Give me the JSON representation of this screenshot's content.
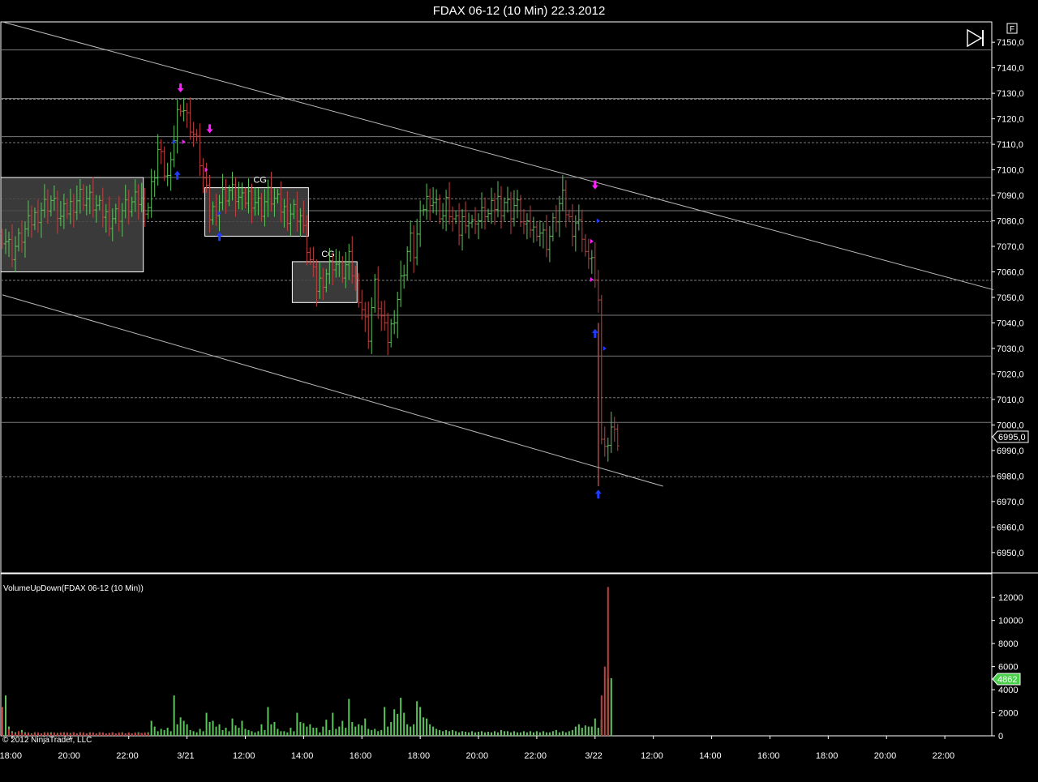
{
  "title": "FDAX 06-12 (10 Min)  22.3.2012",
  "copyright": "© 2012 NinjaTrader, LLC",
  "f_button": "F",
  "indicator_label": "VolumeUpDown(FDAX 06-12 (10 Min))",
  "box_labels": [
    "CG",
    "CG"
  ],
  "colors": {
    "up": "#5ec45e",
    "down": "#c04040",
    "grid": "#7a7a7a",
    "frame": "#ffffff",
    "box": "#444444",
    "buy": "#1e3cff",
    "sell": "#ff20ff"
  },
  "chart_data": [
    {
      "type": "candlestick",
      "title": "FDAX 06-12 (10 Min)  22.3.2012",
      "ylim": [
        6942,
        7158
      ],
      "yticks": [
        "7150,0",
        "7140,0",
        "7130,0",
        "7120,0",
        "7110,0",
        "7100,0",
        "7090,0",
        "7080,0",
        "7070,0",
        "7060,0",
        "7050,0",
        "7040,0",
        "7030,0",
        "7020,0",
        "7010,0",
        "7000,0",
        "6990,0",
        "6980,0",
        "6970,0",
        "6960,0",
        "6950,0"
      ],
      "last_price": "6995,0",
      "xticks": [
        "18:00",
        "20:00",
        "22:00",
        "3/21",
        "12:00",
        "14:00",
        "16:00",
        "18:00",
        "20:00",
        "22:00",
        "3/22",
        "12:00",
        "14:00",
        "16:00",
        "18:00",
        "20:00",
        "22:00"
      ],
      "price_path": [
        [
          0,
          7075
        ],
        [
          3,
          7068
        ],
        [
          6,
          7074
        ],
        [
          9,
          7080
        ],
        [
          12,
          7085
        ],
        [
          15,
          7088
        ],
        [
          18,
          7081
        ],
        [
          21,
          7086
        ],
        [
          24,
          7090
        ],
        [
          27,
          7088
        ],
        [
          30,
          7084
        ],
        [
          33,
          7081
        ],
        [
          36,
          7083
        ],
        [
          39,
          7086
        ],
        [
          42,
          7088
        ],
        [
          45,
          7086
        ],
        [
          47,
          7100
        ],
        [
          48,
          7108
        ],
        [
          49,
          7104
        ],
        [
          50,
          7100
        ],
        [
          51,
          7097
        ],
        [
          52,
          7100
        ],
        [
          53,
          7113
        ],
        [
          54,
          7122
        ],
        [
          55,
          7127
        ],
        [
          56,
          7124
        ],
        [
          57,
          7120
        ],
        [
          58,
          7118
        ],
        [
          59,
          7114
        ],
        [
          60,
          7110
        ],
        [
          61,
          7104
        ],
        [
          62,
          7096
        ],
        [
          63,
          7090
        ],
        [
          64,
          7082
        ],
        [
          66,
          7086
        ],
        [
          68,
          7090
        ],
        [
          70,
          7092
        ],
        [
          72,
          7090
        ],
        [
          74,
          7087
        ],
        [
          76,
          7090
        ],
        [
          78,
          7088
        ],
        [
          80,
          7085
        ],
        [
          82,
          7090
        ],
        [
          84,
          7088
        ],
        [
          86,
          7085
        ],
        [
          88,
          7083
        ],
        [
          90,
          7084
        ],
        [
          92,
          7082
        ],
        [
          93,
          7075
        ],
        [
          94,
          7070
        ],
        [
          95,
          7064
        ],
        [
          96,
          7058
        ],
        [
          97,
          7054
        ],
        [
          98,
          7056
        ],
        [
          99,
          7058
        ],
        [
          100,
          7060
        ],
        [
          101,
          7062
        ],
        [
          102,
          7064
        ],
        [
          103,
          7063
        ],
        [
          104,
          7061
        ],
        [
          105,
          7060
        ],
        [
          106,
          7062
        ],
        [
          107,
          7064
        ],
        [
          108,
          7060
        ],
        [
          109,
          7056
        ],
        [
          110,
          7052
        ],
        [
          111,
          7046
        ],
        [
          112,
          7040
        ],
        [
          113,
          7036
        ],
        [
          114,
          7046
        ],
        [
          115,
          7054
        ],
        [
          116,
          7048
        ],
        [
          117,
          7042
        ],
        [
          118,
          7036
        ],
        [
          119,
          7034
        ],
        [
          120,
          7038
        ],
        [
          121,
          7044
        ],
        [
          122,
          7050
        ],
        [
          123,
          7056
        ],
        [
          124,
          7062
        ],
        [
          125,
          7068
        ],
        [
          126,
          7072
        ],
        [
          127,
          7068
        ],
        [
          128,
          7074
        ],
        [
          129,
          7080
        ],
        [
          130,
          7086
        ],
        [
          131,
          7088
        ],
        [
          132,
          7090
        ],
        [
          133,
          7088
        ],
        [
          134,
          7086
        ],
        [
          135,
          7084
        ],
        [
          136,
          7082
        ],
        [
          137,
          7086
        ],
        [
          138,
          7084
        ],
        [
          139,
          7080
        ],
        [
          140,
          7078
        ],
        [
          141,
          7076
        ],
        [
          142,
          7080
        ],
        [
          143,
          7082
        ],
        [
          144,
          7080
        ],
        [
          145,
          7078
        ],
        [
          146,
          7082
        ],
        [
          147,
          7080
        ],
        [
          148,
          7082
        ],
        [
          149,
          7084
        ],
        [
          150,
          7082
        ],
        [
          151,
          7084
        ],
        [
          152,
          7086
        ],
        [
          153,
          7088
        ],
        [
          154,
          7086
        ],
        [
          155,
          7088
        ],
        [
          156,
          7086
        ],
        [
          157,
          7084
        ],
        [
          158,
          7086
        ],
        [
          159,
          7085
        ],
        [
          160,
          7082
        ],
        [
          161,
          7078
        ],
        [
          162,
          7076
        ],
        [
          163,
          7078
        ],
        [
          164,
          7076
        ],
        [
          165,
          7078
        ],
        [
          166,
          7076
        ],
        [
          167,
          7074
        ],
        [
          168,
          7072
        ],
        [
          169,
          7074
        ],
        [
          170,
          7078
        ],
        [
          171,
          7082
        ],
        [
          172,
          7086
        ],
        [
          173,
          7088
        ],
        [
          174,
          7084
        ],
        [
          175,
          7080
        ],
        [
          176,
          7078
        ],
        [
          177,
          7080
        ],
        [
          178,
          7078
        ],
        [
          179,
          7076
        ],
        [
          180,
          7068
        ],
        [
          181,
          7062
        ],
        [
          182,
          7068
        ],
        [
          183,
          7056
        ],
        [
          184,
          7045
        ],
        [
          185,
          6996
        ],
        [
          186,
          6990
        ],
        [
          187,
          6996
        ],
        [
          188,
          7000
        ],
        [
          189,
          6996
        ],
        [
          190,
          6995
        ]
      ],
      "trendlines": [
        {
          "from": [
            0,
            7158
          ],
          "to": [
            306,
            7053
          ]
        },
        {
          "from": [
            0,
            7051
          ],
          "to": [
            204,
            6976
          ]
        }
      ],
      "horizontal_lines_solid": [
        7147,
        7128,
        7113,
        7097,
        7084,
        7043,
        7027,
        7001
      ],
      "horizontal_lines_dashed": [
        7128,
        7111,
        7089,
        7080,
        7057,
        7011,
        6980
      ],
      "boxes": [
        {
          "from": 0,
          "to": 44,
          "high": 7097,
          "low": 7060,
          "label": ""
        },
        {
          "from": 63,
          "to": 95,
          "high": 7093,
          "low": 7074,
          "label": "CG"
        },
        {
          "from": 90,
          "to": 110,
          "high": 7064,
          "low": 7048,
          "label": "CG"
        }
      ],
      "markers": [
        {
          "x": 55,
          "price": 7131,
          "kind": "sell"
        },
        {
          "x": 64,
          "price": 7115,
          "kind": "sell"
        },
        {
          "x": 183,
          "price": 7093,
          "kind": "sell"
        },
        {
          "x": 54,
          "price": 7099,
          "kind": "buy"
        },
        {
          "x": 67,
          "price": 7075,
          "kind": "buy"
        },
        {
          "x": 183,
          "price": 7037,
          "kind": "buy"
        },
        {
          "x": 184,
          "price": 6974,
          "kind": "buy"
        }
      ]
    },
    {
      "type": "bar",
      "title": "VolumeUpDown(FDAX 06-12 (10 Min))",
      "ylim": [
        0,
        13000
      ],
      "yticks": [
        "12000",
        "10000",
        "8000",
        "6000",
        "4000",
        "2000",
        "0"
      ],
      "last_value": "4862",
      "up_volume": [
        0,
        3500,
        800,
        400,
        300,
        200,
        500,
        300,
        200,
        200,
        300,
        200,
        200,
        300,
        200,
        300,
        200,
        250,
        200,
        300,
        200,
        250,
        300,
        200,
        300,
        200,
        200,
        300,
        250,
        200,
        300,
        250,
        200,
        250,
        300,
        200,
        200,
        300,
        200,
        250,
        200,
        200,
        300,
        250,
        200,
        300,
        1300,
        800,
        400,
        600,
        500,
        700,
        400,
        3500,
        1000,
        1600,
        1300,
        1000,
        500,
        400,
        300,
        600,
        400,
        2000,
        1200,
        1300,
        800,
        1000,
        500,
        700,
        400,
        1500,
        900,
        700,
        1300,
        600,
        500,
        400,
        300,
        400,
        1000,
        500,
        2500,
        1000,
        1200,
        600,
        400,
        400,
        300,
        700,
        400,
        2000,
        1200,
        1100,
        800,
        1000,
        700,
        700,
        300,
        800,
        1400,
        500,
        2000,
        600,
        800,
        1300,
        700,
        3200,
        1200,
        800,
        1000,
        900,
        1500,
        600,
        500,
        600,
        400,
        500,
        2500,
        800,
        1200,
        2300,
        1900,
        3300,
        2000,
        1000,
        800,
        1000,
        3000,
        2500,
        1600,
        1500,
        1000,
        800,
        600,
        500,
        400,
        500,
        400,
        500,
        400,
        300,
        400,
        350,
        300,
        400,
        300,
        350,
        400,
        300,
        350,
        300,
        400,
        300,
        500,
        400,
        400,
        300,
        400,
        300,
        300,
        400,
        300,
        400,
        300,
        400,
        300,
        400,
        300,
        300,
        400,
        500,
        300,
        400,
        300,
        400,
        500,
        800,
        1000,
        700,
        900,
        800,
        800,
        1500,
        700,
        1400,
        0,
        5000,
        5000
      ],
      "down_volume": [
        2500,
        0,
        600,
        300,
        200,
        400,
        300,
        200,
        300,
        150,
        250,
        300,
        200,
        250,
        300,
        200,
        300,
        200,
        300,
        250,
        300,
        200,
        300,
        200,
        250,
        300,
        200,
        250,
        300,
        200,
        250,
        300,
        200,
        250,
        300,
        200,
        300,
        250,
        200,
        300,
        200,
        300,
        200,
        250,
        300,
        200,
        0,
        0,
        0,
        0,
        0,
        0,
        0,
        0,
        0,
        0,
        0,
        0,
        0,
        0,
        0,
        0,
        0,
        0,
        0,
        0,
        0,
        0,
        0,
        0,
        0,
        0,
        0,
        0,
        0,
        0,
        0,
        0,
        0,
        0,
        0,
        0,
        0,
        0,
        0,
        0,
        0,
        0,
        0,
        0,
        0,
        0,
        0,
        0,
        0,
        0,
        0,
        0,
        0,
        0,
        0,
        0,
        0,
        0,
        0,
        0,
        0,
        0,
        0,
        0,
        0,
        0,
        0,
        0,
        0,
        0,
        0,
        0,
        0,
        0,
        0,
        0,
        0,
        0,
        0,
        0,
        0,
        0,
        0,
        0,
        0,
        0,
        0,
        0,
        0,
        0,
        0,
        0,
        0,
        0,
        0,
        0,
        0,
        0,
        0,
        0,
        0,
        0,
        0,
        0,
        0,
        0,
        0,
        0,
        0,
        0,
        0,
        0,
        0,
        0,
        0,
        0,
        0,
        0,
        0,
        0,
        0,
        0,
        0,
        0,
        0,
        0,
        0,
        0,
        0,
        0,
        0,
        0,
        0,
        0,
        0,
        0,
        0,
        0,
        0,
        3500,
        6000,
        12900,
        0,
        0
      ]
    }
  ]
}
